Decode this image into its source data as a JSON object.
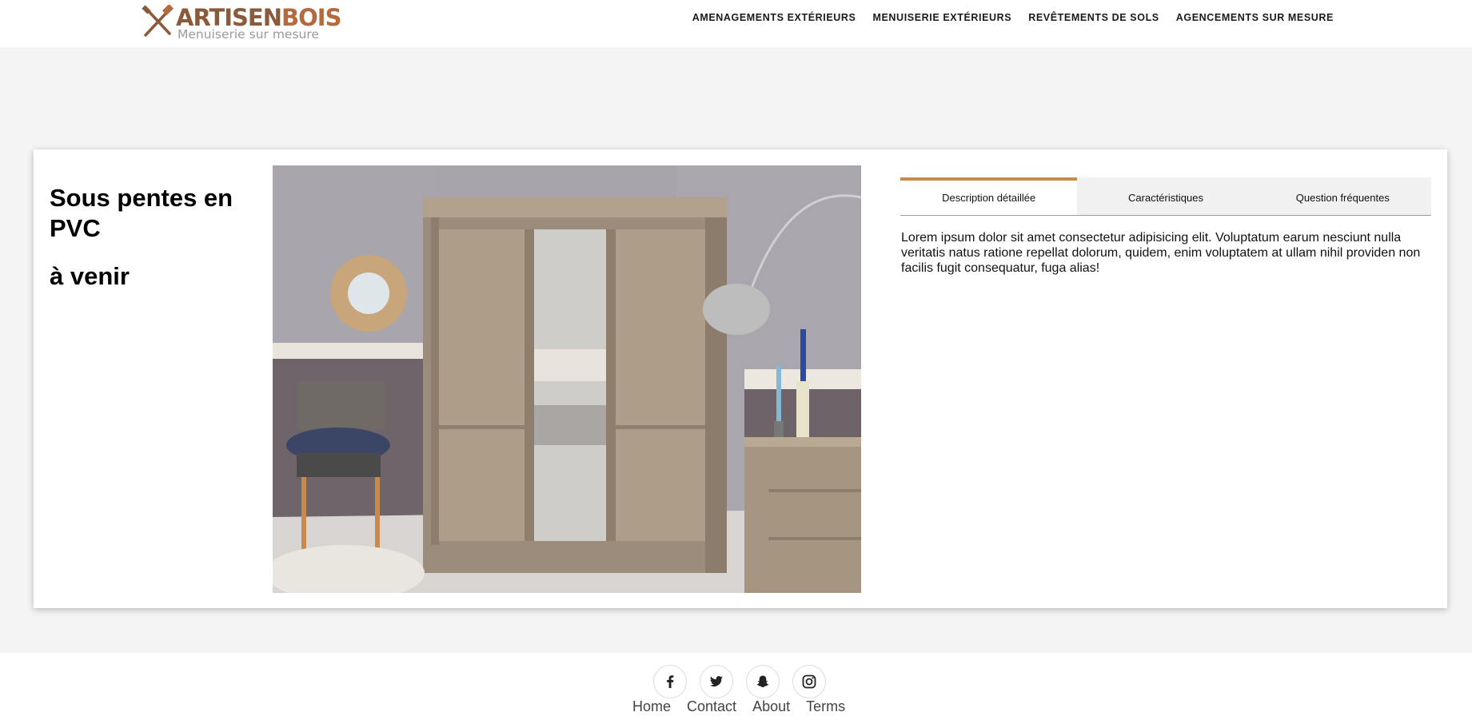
{
  "header": {
    "logo": {
      "brand_part1": "ARTISEN",
      "brand_part2": "BOIS",
      "tagline": "Menuiserie sur mesure"
    },
    "nav": [
      {
        "label": "AMENAGEMENTS EXTÉRIEURS"
      },
      {
        "label": "MENUISERIE EXTÉRIEURS"
      },
      {
        "label": "REVÊTEMENTS DE SOLS"
      },
      {
        "label": "AGENCEMENTS SUR MESURE"
      }
    ]
  },
  "product": {
    "title": "Sous pentes en PVC",
    "subtitle": "à venir",
    "tabs": [
      {
        "label": "Description détaillée",
        "active": true
      },
      {
        "label": "Caractéristiques",
        "active": false
      },
      {
        "label": "Question fréquentes",
        "active": false
      }
    ],
    "description": "Lorem ipsum dolor sit amet consectetur adipisicing elit. Voluptatum earum nesciunt nulla veritatis natus ratione repellat dolorum, quidem, enim voluptatem at ullam nihil providen non facilis fugit consequatur, fuga alias!"
  },
  "footer": {
    "socials": [
      {
        "icon": "facebook-icon"
      },
      {
        "icon": "twitter-icon"
      },
      {
        "icon": "snapchat-icon"
      },
      {
        "icon": "instagram-icon"
      }
    ],
    "links": [
      {
        "label": "Home"
      },
      {
        "label": "Contact"
      },
      {
        "label": "About"
      },
      {
        "label": "Terms"
      }
    ]
  },
  "colors": {
    "accent": "#c98a4e",
    "brand_dark": "#8a5a3a",
    "brand_light": "#b46a3c",
    "page_bg": "#f4f4f4"
  }
}
